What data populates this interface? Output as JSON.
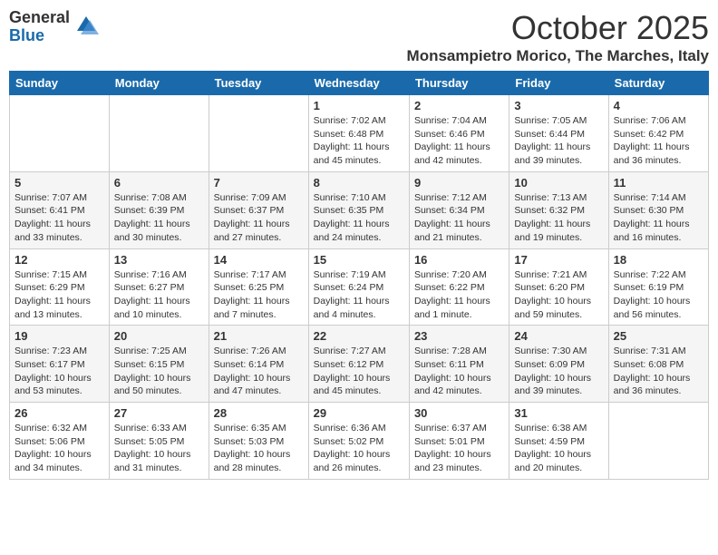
{
  "logo": {
    "general": "General",
    "blue": "Blue"
  },
  "title": "October 2025",
  "location": "Monsampietro Morico, The Marches, Italy",
  "weekdays": [
    "Sunday",
    "Monday",
    "Tuesday",
    "Wednesday",
    "Thursday",
    "Friday",
    "Saturday"
  ],
  "weeks": [
    [
      {
        "day": null,
        "info": null
      },
      {
        "day": null,
        "info": null
      },
      {
        "day": null,
        "info": null
      },
      {
        "day": "1",
        "info": "Sunrise: 7:02 AM\nSunset: 6:48 PM\nDaylight: 11 hours and 45 minutes."
      },
      {
        "day": "2",
        "info": "Sunrise: 7:04 AM\nSunset: 6:46 PM\nDaylight: 11 hours and 42 minutes."
      },
      {
        "day": "3",
        "info": "Sunrise: 7:05 AM\nSunset: 6:44 PM\nDaylight: 11 hours and 39 minutes."
      },
      {
        "day": "4",
        "info": "Sunrise: 7:06 AM\nSunset: 6:42 PM\nDaylight: 11 hours and 36 minutes."
      }
    ],
    [
      {
        "day": "5",
        "info": "Sunrise: 7:07 AM\nSunset: 6:41 PM\nDaylight: 11 hours and 33 minutes."
      },
      {
        "day": "6",
        "info": "Sunrise: 7:08 AM\nSunset: 6:39 PM\nDaylight: 11 hours and 30 minutes."
      },
      {
        "day": "7",
        "info": "Sunrise: 7:09 AM\nSunset: 6:37 PM\nDaylight: 11 hours and 27 minutes."
      },
      {
        "day": "8",
        "info": "Sunrise: 7:10 AM\nSunset: 6:35 PM\nDaylight: 11 hours and 24 minutes."
      },
      {
        "day": "9",
        "info": "Sunrise: 7:12 AM\nSunset: 6:34 PM\nDaylight: 11 hours and 21 minutes."
      },
      {
        "day": "10",
        "info": "Sunrise: 7:13 AM\nSunset: 6:32 PM\nDaylight: 11 hours and 19 minutes."
      },
      {
        "day": "11",
        "info": "Sunrise: 7:14 AM\nSunset: 6:30 PM\nDaylight: 11 hours and 16 minutes."
      }
    ],
    [
      {
        "day": "12",
        "info": "Sunrise: 7:15 AM\nSunset: 6:29 PM\nDaylight: 11 hours and 13 minutes."
      },
      {
        "day": "13",
        "info": "Sunrise: 7:16 AM\nSunset: 6:27 PM\nDaylight: 11 hours and 10 minutes."
      },
      {
        "day": "14",
        "info": "Sunrise: 7:17 AM\nSunset: 6:25 PM\nDaylight: 11 hours and 7 minutes."
      },
      {
        "day": "15",
        "info": "Sunrise: 7:19 AM\nSunset: 6:24 PM\nDaylight: 11 hours and 4 minutes."
      },
      {
        "day": "16",
        "info": "Sunrise: 7:20 AM\nSunset: 6:22 PM\nDaylight: 11 hours and 1 minute."
      },
      {
        "day": "17",
        "info": "Sunrise: 7:21 AM\nSunset: 6:20 PM\nDaylight: 10 hours and 59 minutes."
      },
      {
        "day": "18",
        "info": "Sunrise: 7:22 AM\nSunset: 6:19 PM\nDaylight: 10 hours and 56 minutes."
      }
    ],
    [
      {
        "day": "19",
        "info": "Sunrise: 7:23 AM\nSunset: 6:17 PM\nDaylight: 10 hours and 53 minutes."
      },
      {
        "day": "20",
        "info": "Sunrise: 7:25 AM\nSunset: 6:15 PM\nDaylight: 10 hours and 50 minutes."
      },
      {
        "day": "21",
        "info": "Sunrise: 7:26 AM\nSunset: 6:14 PM\nDaylight: 10 hours and 47 minutes."
      },
      {
        "day": "22",
        "info": "Sunrise: 7:27 AM\nSunset: 6:12 PM\nDaylight: 10 hours and 45 minutes."
      },
      {
        "day": "23",
        "info": "Sunrise: 7:28 AM\nSunset: 6:11 PM\nDaylight: 10 hours and 42 minutes."
      },
      {
        "day": "24",
        "info": "Sunrise: 7:30 AM\nSunset: 6:09 PM\nDaylight: 10 hours and 39 minutes."
      },
      {
        "day": "25",
        "info": "Sunrise: 7:31 AM\nSunset: 6:08 PM\nDaylight: 10 hours and 36 minutes."
      }
    ],
    [
      {
        "day": "26",
        "info": "Sunrise: 6:32 AM\nSunset: 5:06 PM\nDaylight: 10 hours and 34 minutes."
      },
      {
        "day": "27",
        "info": "Sunrise: 6:33 AM\nSunset: 5:05 PM\nDaylight: 10 hours and 31 minutes."
      },
      {
        "day": "28",
        "info": "Sunrise: 6:35 AM\nSunset: 5:03 PM\nDaylight: 10 hours and 28 minutes."
      },
      {
        "day": "29",
        "info": "Sunrise: 6:36 AM\nSunset: 5:02 PM\nDaylight: 10 hours and 26 minutes."
      },
      {
        "day": "30",
        "info": "Sunrise: 6:37 AM\nSunset: 5:01 PM\nDaylight: 10 hours and 23 minutes."
      },
      {
        "day": "31",
        "info": "Sunrise: 6:38 AM\nSunset: 4:59 PM\nDaylight: 10 hours and 20 minutes."
      },
      {
        "day": null,
        "info": null
      }
    ]
  ]
}
